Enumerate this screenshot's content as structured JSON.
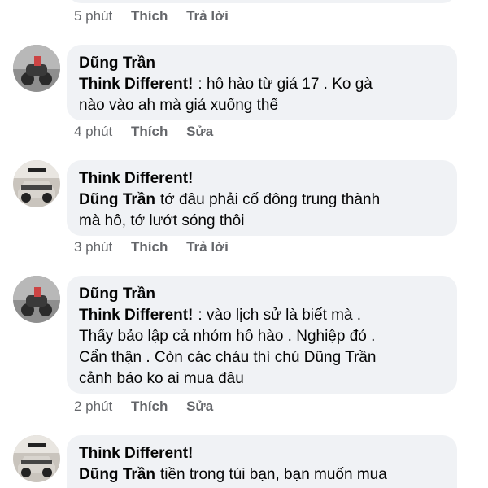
{
  "comments": [
    {
      "actions": {
        "time": "5 phút",
        "like": "Thích",
        "reply": "Trả lời"
      }
    },
    {
      "avatar": "motorbike-avatar",
      "author": "Dũng Trần",
      "mention": "Think Different!",
      "text_lines": [
        ":  hô hào từ giá 17  . Ko gà",
        "nào vào ah mà giá xuống thế"
      ],
      "actions": {
        "time": "4 phút",
        "like": "Thích",
        "reply": "Sửa"
      }
    },
    {
      "avatar": "car-avatar",
      "author": "Think Different!",
      "mention": "Dũng Trần",
      "text_lines": [
        "tớ đâu phải cố đông trung thành",
        "mà hô, tớ lướt sóng thôi"
      ],
      "actions": {
        "time": "3 phút",
        "like": "Thích",
        "reply": "Trả lời"
      }
    },
    {
      "avatar": "motorbike-avatar",
      "author": "Dũng Trần",
      "mention": "Think Different!",
      "text_lines": [
        ": vào lịch sử là biết mà .",
        "Thấy bảo lập cả nhóm hô hào . Nghiệp đó .",
        "Cẩn thận . Còn các cháu thì chú Dũng Trần",
        "cảnh báo ko ai mua đâu"
      ],
      "actions": {
        "time": "2 phút",
        "like": "Thích",
        "reply": "Sửa"
      }
    },
    {
      "avatar": "car-avatar",
      "author": "Think Different!",
      "mention": "Dũng Trần",
      "text_lines": [
        "tiền trong túi bạn, bạn muốn mua"
      ]
    }
  ],
  "colors": {
    "bubble": "#f0f2f5",
    "meta": "#65676b",
    "text": "#050505"
  }
}
